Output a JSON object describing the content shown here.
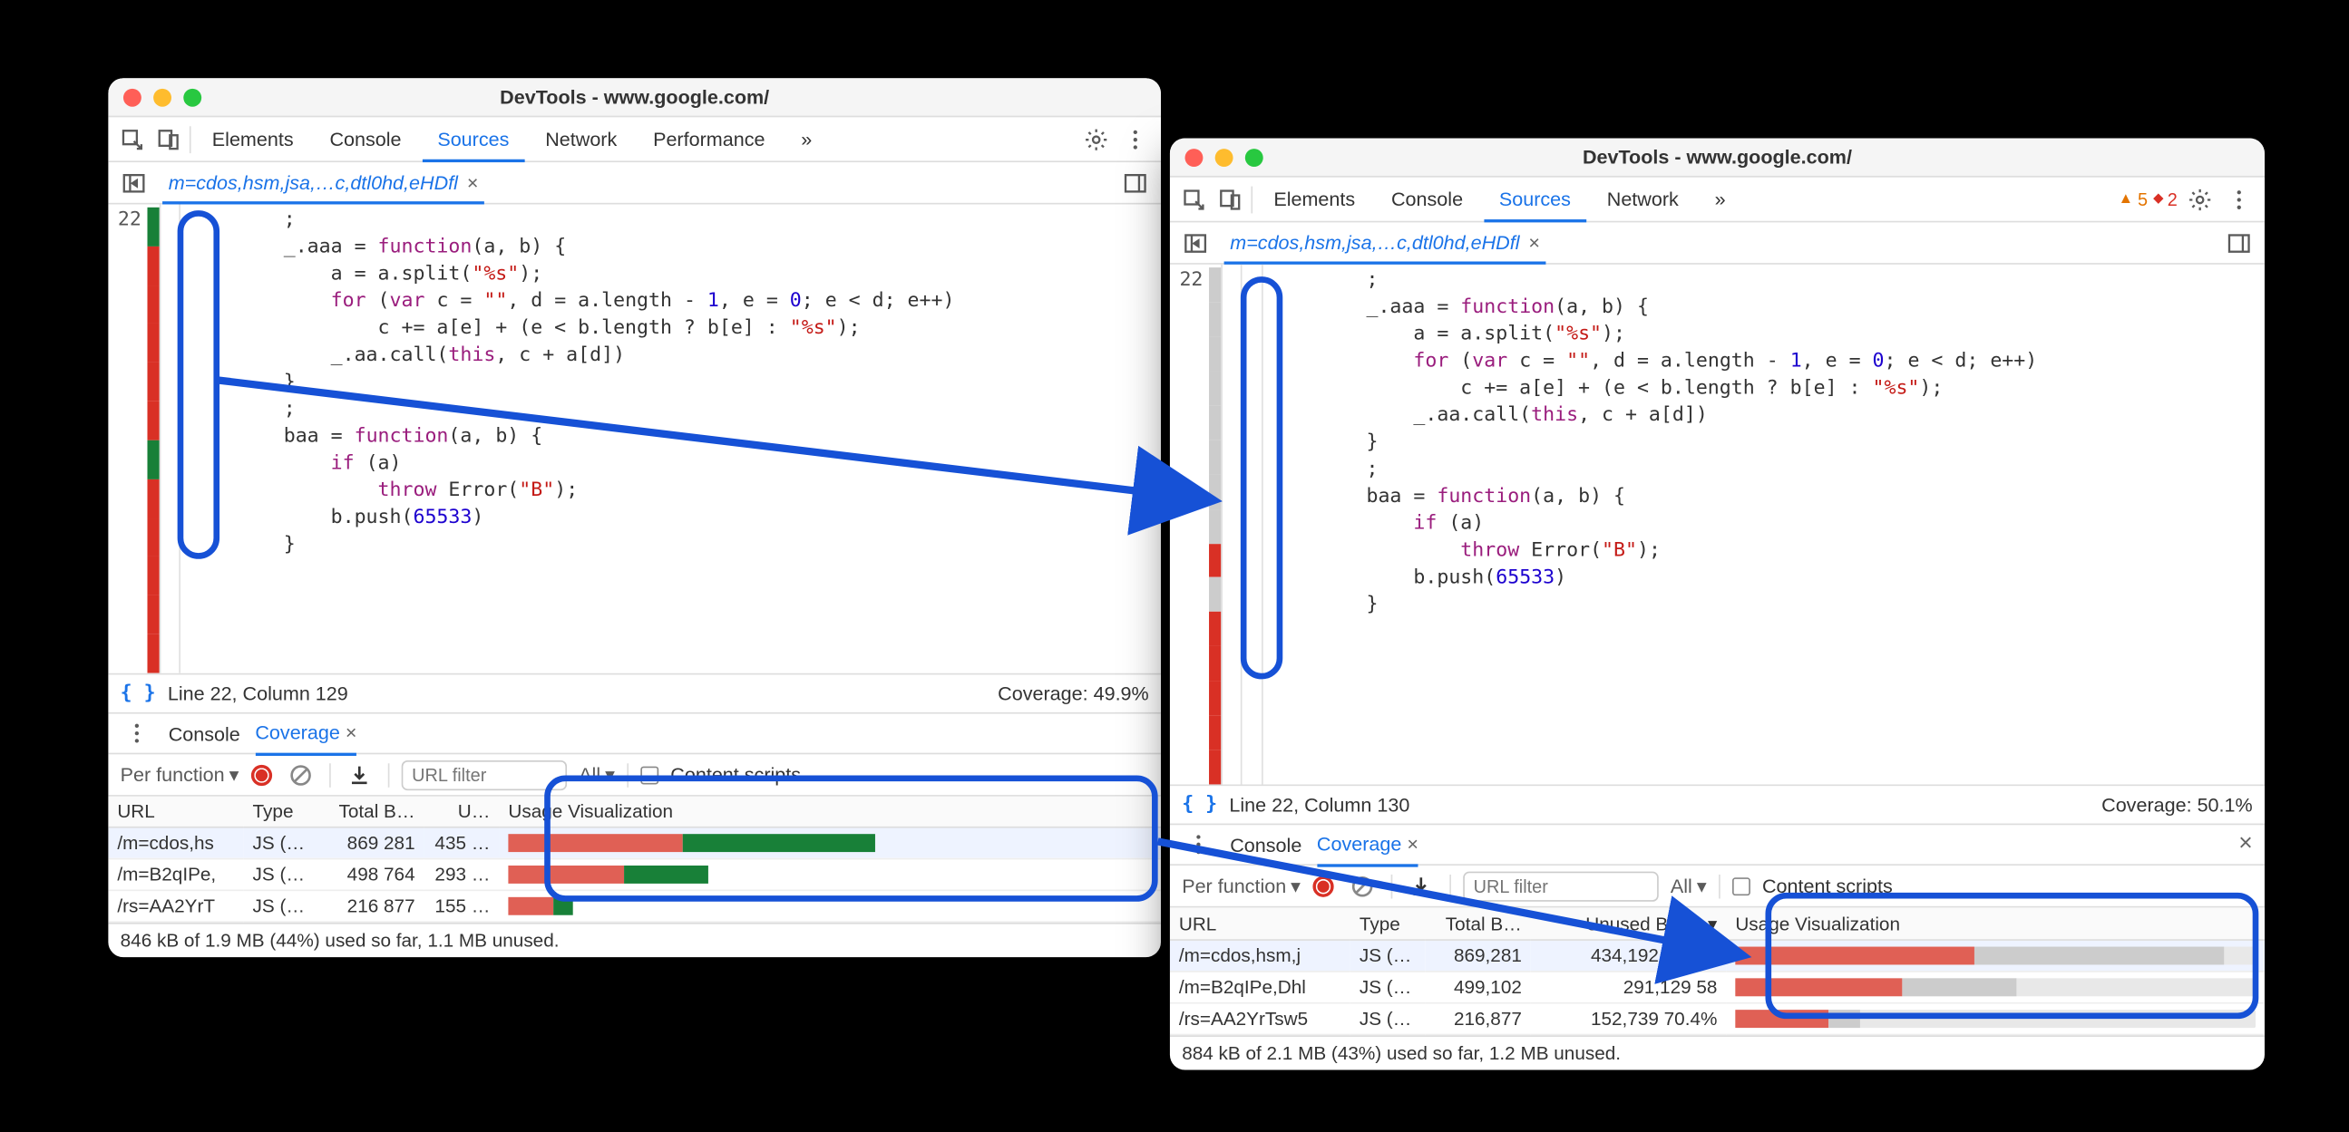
{
  "windowA": {
    "title": "DevTools - www.google.com/",
    "tabs": {
      "elements": "Elements",
      "console": "Console",
      "sources": "Sources",
      "network": "Network",
      "performance": "Performance",
      "more": "»"
    },
    "file_tab": "m=cdos,hsm,jsa,…c,dtl0hd,eHDfl",
    "line_no": "22",
    "cov_colors": [
      "g",
      "r",
      "r",
      "r",
      "r",
      "r",
      "g",
      "r",
      "r",
      "r",
      "r",
      "r"
    ],
    "status": {
      "pos": "Line 22, Column 129",
      "cov": "Coverage: 49.9%"
    },
    "drawer": {
      "console": "Console",
      "coverage": "Coverage"
    },
    "toolbar": {
      "per_function": "Per function",
      "url_ph": "URL filter",
      "all": "All",
      "content_scripts": "Content scripts"
    },
    "headers": {
      "url": "URL",
      "type": "Type",
      "total": "Total B…",
      "unused": "U…",
      "usage": "Usage Visualization"
    },
    "rows": [
      {
        "url": "/m=cdos,hs",
        "type": "JS (…",
        "total": "869 281",
        "unused": "435 …",
        "red": 0.27,
        "green": 0.3,
        "selected": true
      },
      {
        "url": "/m=B2qIPe,",
        "type": "JS (…",
        "total": "498 764",
        "unused": "293 …",
        "red": 0.18,
        "green": 0.13,
        "selected": false
      },
      {
        "url": "/rs=AA2YrT",
        "type": "JS (…",
        "total": "216 877",
        "unused": "155 …",
        "red": 0.07,
        "green": 0.03,
        "selected": false
      }
    ],
    "footer": "846 kB of 1.9 MB (44%) used so far, 1.1 MB unused."
  },
  "windowB": {
    "title": "DevTools - www.google.com/",
    "tabs": {
      "elements": "Elements",
      "console": "Console",
      "sources": "Sources",
      "network": "Network",
      "more": "»"
    },
    "warn": "5",
    "err": "2",
    "file_tab": "m=cdos,hsm,jsa,…c,dtl0hd,eHDfl",
    "line_no": "22",
    "cov_colors": [
      "x",
      "x",
      "x",
      "x",
      "x",
      "x",
      "x",
      "x",
      "r",
      "x",
      "r",
      "r",
      "r",
      "r",
      "r"
    ],
    "status": {
      "pos": "Line 22, Column 130",
      "cov": "Coverage: 50.1%"
    },
    "drawer": {
      "console": "Console",
      "coverage": "Coverage"
    },
    "toolbar": {
      "per_function": "Per function",
      "url_ph": "URL filter",
      "all": "All",
      "content_scripts": "Content scripts"
    },
    "headers": {
      "url": "URL",
      "type": "Type",
      "total": "Total B…",
      "unused": "Unused Bytes ▾",
      "usage": "Usage Visualization"
    },
    "rows": [
      {
        "url": "/m=cdos,hsm,j",
        "type": "JS (…",
        "total": "869,281",
        "unused": "434,192  49.9%",
        "red": 0.46,
        "grey": 0.48,
        "selected": true
      },
      {
        "url": "/m=B2qIPe,Dhl",
        "type": "JS (…",
        "total": "499,102",
        "unused": "291,129  58",
        "red": 0.32,
        "grey": 0.22,
        "selected": false
      },
      {
        "url": "/rs=AA2YrTsw5",
        "type": "JS (…",
        "total": "216,877",
        "unused": "152,739  70.4%",
        "red": 0.18,
        "grey": 0.06,
        "selected": false
      }
    ],
    "footer": "884 kB of 2.1 MB (43%) used so far, 1.2 MB unused."
  },
  "code": {
    "l0": "        ;",
    "l1a": "        _.aaa = ",
    "l1kw": "function",
    "l1b": "(a, b) {",
    "l2a": "            a = a.split(",
    "l2s": "\"%s\"",
    "l2b": ");",
    "l3a": "            ",
    "l3for": "for ",
    "l3b": "(",
    "l3var": "var ",
    "l3c": "c = ",
    "l3s": "\"\"",
    "l3d": ", d = a.length - ",
    "l3n1": "1",
    "l3e": ", e = ",
    "l3n0": "0",
    "l3f": "; e < d; e++)",
    "l4a": "                c += a[e] + (e < b.length ? b[e] : ",
    "l4s": "\"%s\"",
    "l4b": ");",
    "l5a": "            _.aa.call(",
    "l5kw": "this",
    "l5b": ", c + a[d])",
    "l6": "        }",
    "l7": "        ;",
    "l8a": "        baa = ",
    "l8kw": "function",
    "l8b": "(a, b) {",
    "l9a": "            ",
    "l9kw": "if ",
    "l9b": "(a)",
    "l10a": "                ",
    "l10kw": "throw ",
    "l10b": "Error(",
    "l10s": "\"B\"",
    "l10c": ");",
    "l11a": "            b.push(",
    "l11n": "65533",
    "l11b": ")",
    "l12": "        }"
  }
}
